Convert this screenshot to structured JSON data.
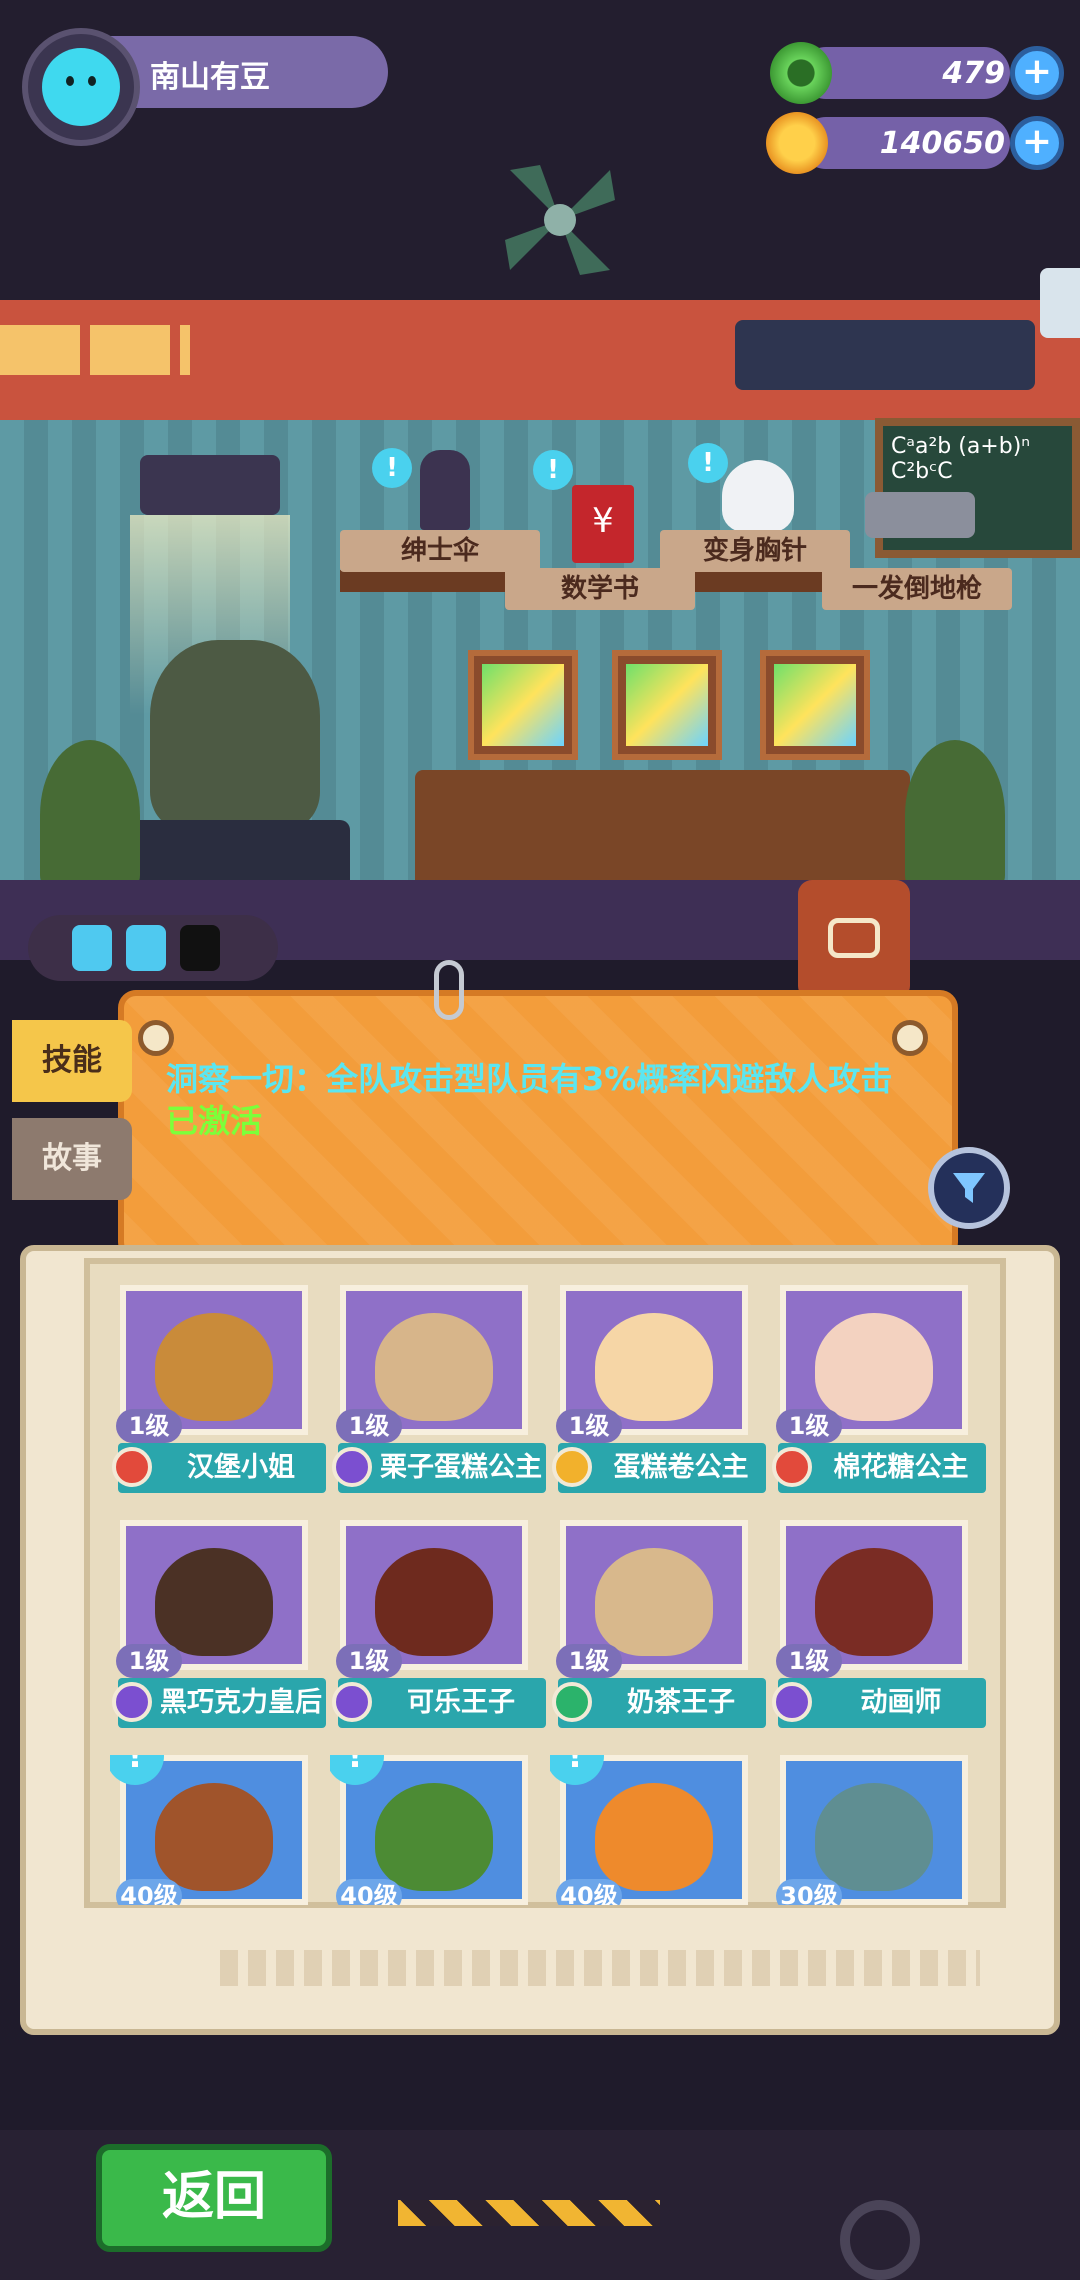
{
  "player": {
    "name": "南山有豆",
    "avatar_icon": "cat-face-icon"
  },
  "resources": [
    {
      "name": "gem",
      "icon": "green-gem-coin-icon",
      "value": "479",
      "color": "#5dd05a"
    },
    {
      "name": "coin",
      "icon": "planet-coin-icon",
      "value": "140650",
      "color": "#f2a72a"
    }
  ],
  "plus_label": "+",
  "shelf_items": [
    {
      "label": "绅士伞",
      "icon": "umbrella-icon"
    },
    {
      "label": "数学书",
      "icon": "book-icon"
    },
    {
      "label": "变身胸针",
      "icon": "skull-icon"
    },
    {
      "label": "一发倒地枪",
      "icon": "gun-icon"
    }
  ],
  "hint_mark": "!",
  "board_text": "Cᵃa²b (a+b)ⁿ C²bᶜC",
  "tabs": {
    "skill": "技能",
    "story": "故事"
  },
  "skill_panel": {
    "text": "洞察一切：全队攻击型队员有3%概率闪避敌人攻击",
    "status": "已激活"
  },
  "characters": [
    {
      "level": "1级",
      "name": "汉堡小姐",
      "faction_color": "#e24a3b",
      "face_color": "#c98b3a",
      "locked": false
    },
    {
      "level": "1级",
      "name": "栗子蛋糕公主",
      "faction_color": "#7b4fd0",
      "face_color": "#d7b58a",
      "locked": false
    },
    {
      "level": "1级",
      "name": "蛋糕卷公主",
      "faction_color": "#f2b12c",
      "face_color": "#f6d6a6",
      "locked": false
    },
    {
      "level": "1级",
      "name": "棉花糖公主",
      "faction_color": "#e24a3b",
      "face_color": "#f3d2c0",
      "locked": false
    },
    {
      "level": "1级",
      "name": "黑巧克力皇后",
      "faction_color": "#7b4fd0",
      "face_color": "#4b3125",
      "locked": false
    },
    {
      "level": "1级",
      "name": "可乐王子",
      "faction_color": "#7b4fd0",
      "face_color": "#6e2a1e",
      "locked": false
    },
    {
      "level": "1级",
      "name": "奶茶王子",
      "faction_color": "#2bb36b",
      "face_color": "#d8b88c",
      "locked": false
    },
    {
      "level": "1级",
      "name": "动画师",
      "faction_color": "#7b4fd0",
      "face_color": "#7a2c24",
      "locked": false
    },
    {
      "level": "40级",
      "name": "",
      "faction_color": "#7b4fd0",
      "face_color": "#a0542b",
      "locked": true
    },
    {
      "level": "40级",
      "name": "",
      "faction_color": "#7b4fd0",
      "face_color": "#4c8b34",
      "locked": true
    },
    {
      "level": "40级",
      "name": "",
      "faction_color": "#7b4fd0",
      "face_color": "#ee8a2c",
      "locked": true
    },
    {
      "level": "30级",
      "name": "",
      "faction_color": "#7b4fd0",
      "face_color": "#5f8e92",
      "locked": true
    }
  ],
  "back_button": "返回"
}
